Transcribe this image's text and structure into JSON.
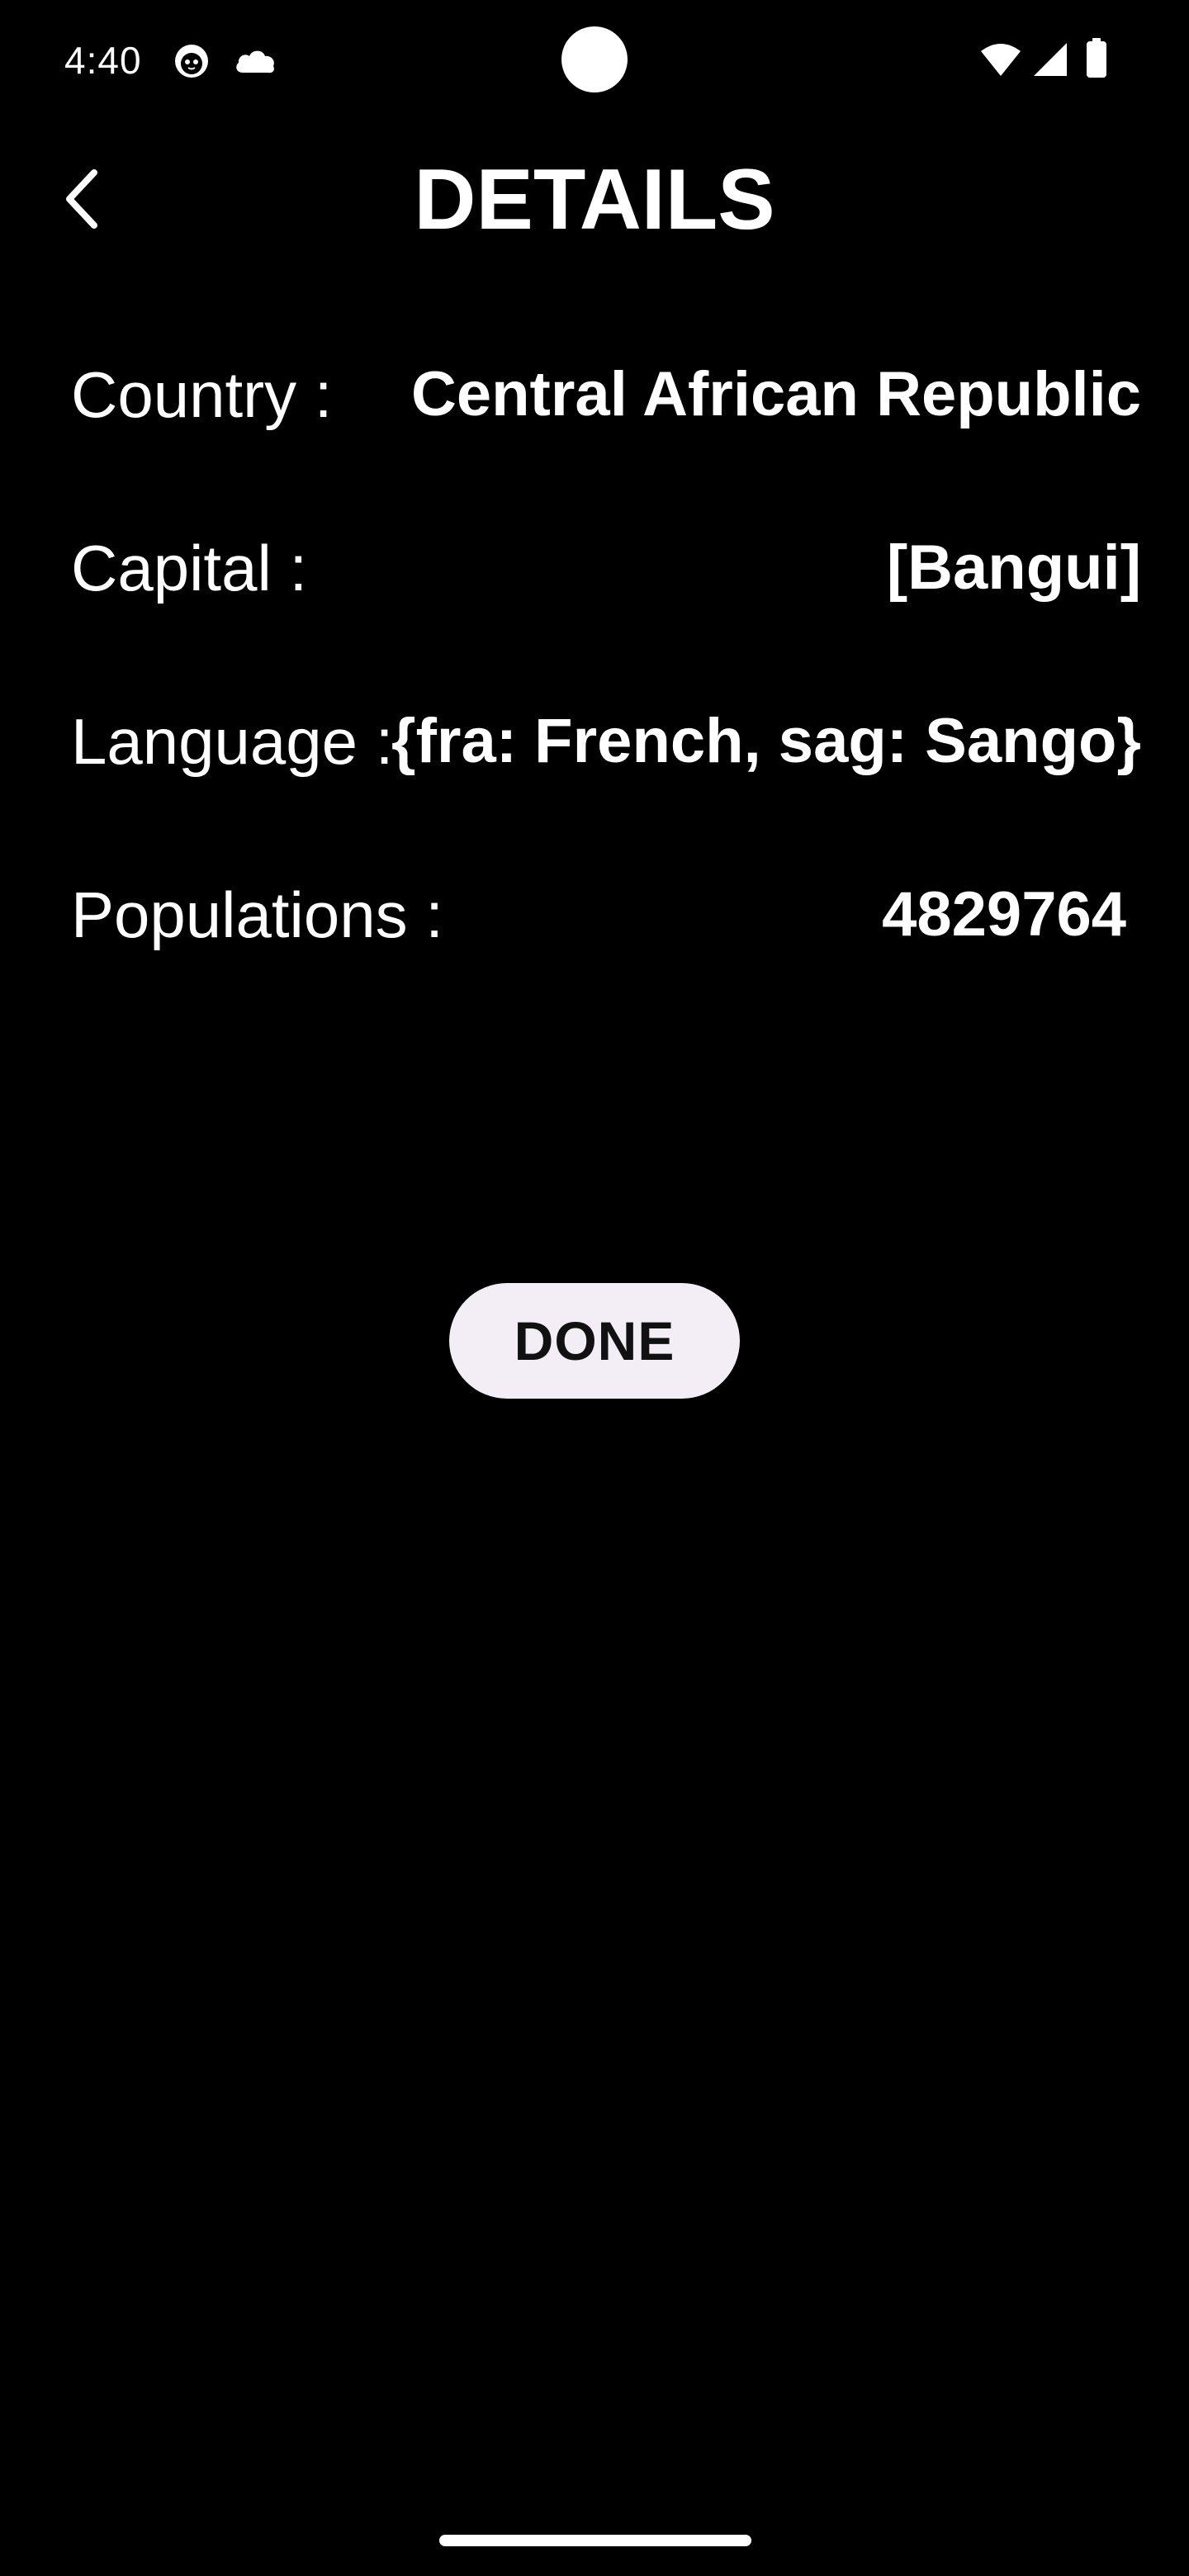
{
  "status_bar": {
    "time": "4:40",
    "left_icons": [
      "cat-face-icon",
      "cloud-icon"
    ],
    "right_icons": [
      "wifi-icon",
      "signal-icon",
      "battery-icon"
    ]
  },
  "header": {
    "title": "DETAILS",
    "back_icon": "chevron-left-icon"
  },
  "details": [
    {
      "label": "Country :",
      "value": "Central African Republic"
    },
    {
      "label": "Capital :",
      "value": "[Bangui]"
    },
    {
      "label": "Language :",
      "value": "{fra: French, sag: Sango}"
    },
    {
      "label": "Populations :",
      "value": "4829764"
    }
  ],
  "actions": {
    "done_label": "DONE"
  },
  "colors": {
    "background": "#000000",
    "text": "#ffffff",
    "button_bg": "#f3eef6",
    "button_text": "#111111"
  }
}
